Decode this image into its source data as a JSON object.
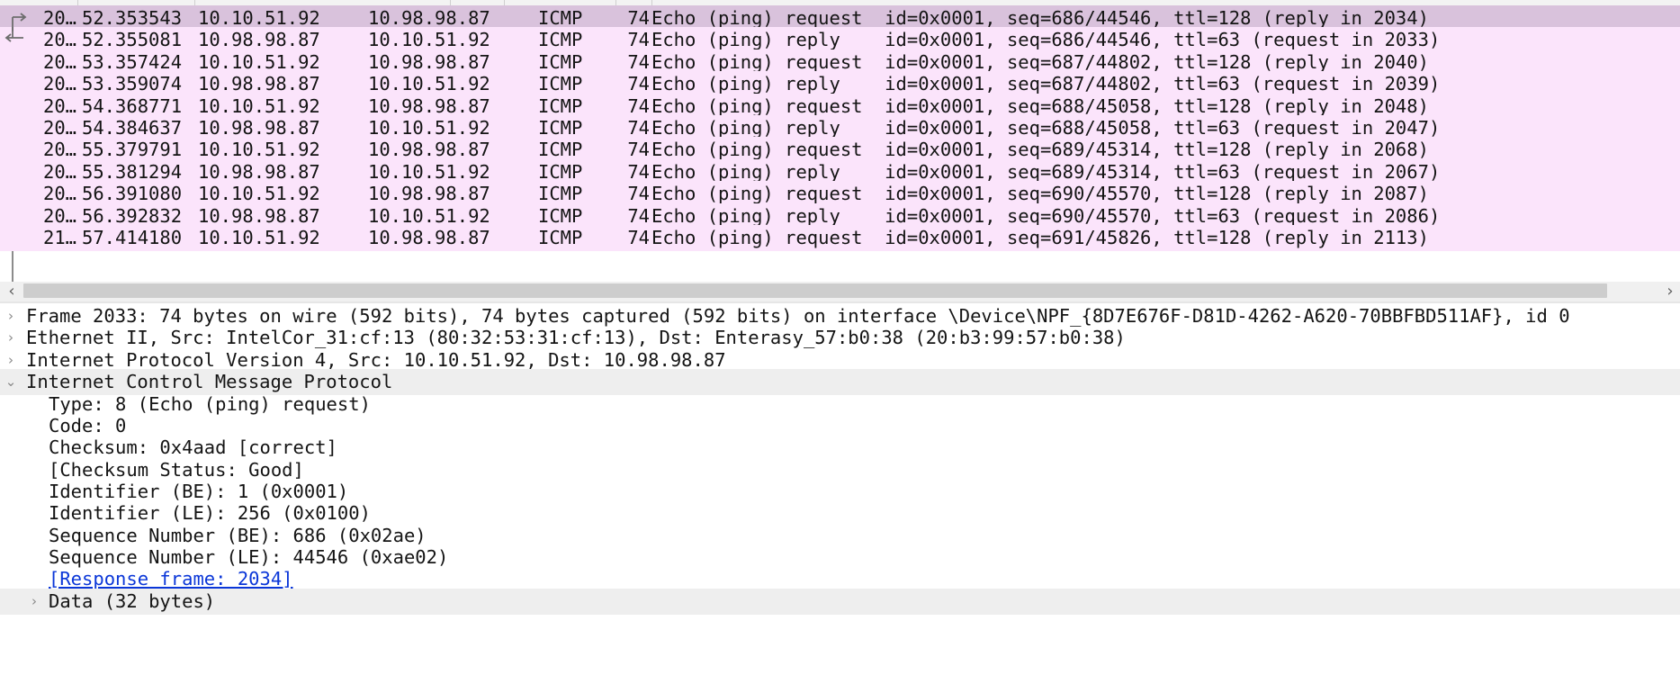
{
  "packet_list": {
    "rows": [
      {
        "no": "20…",
        "time": "52.353543",
        "src": "10.10.51.92",
        "dst": "10.98.98.87",
        "proto": "ICMP",
        "len": "74",
        "info": "Echo (ping) request  id=0x0001, seq=686/44546, ttl=128 (reply in 2034)"
      },
      {
        "no": "20…",
        "time": "52.355081",
        "src": "10.98.98.87",
        "dst": "10.10.51.92",
        "proto": "ICMP",
        "len": "74",
        "info": "Echo (ping) reply    id=0x0001, seq=686/44546, ttl=63 (request in 2033)"
      },
      {
        "no": "20…",
        "time": "53.357424",
        "src": "10.10.51.92",
        "dst": "10.98.98.87",
        "proto": "ICMP",
        "len": "74",
        "info": "Echo (ping) request  id=0x0001, seq=687/44802, ttl=128 (reply in 2040)"
      },
      {
        "no": "20…",
        "time": "53.359074",
        "src": "10.98.98.87",
        "dst": "10.10.51.92",
        "proto": "ICMP",
        "len": "74",
        "info": "Echo (ping) reply    id=0x0001, seq=687/44802, ttl=63 (request in 2039)"
      },
      {
        "no": "20…",
        "time": "54.368771",
        "src": "10.10.51.92",
        "dst": "10.98.98.87",
        "proto": "ICMP",
        "len": "74",
        "info": "Echo (ping) request  id=0x0001, seq=688/45058, ttl=128 (reply in 2048)"
      },
      {
        "no": "20…",
        "time": "54.384637",
        "src": "10.98.98.87",
        "dst": "10.10.51.92",
        "proto": "ICMP",
        "len": "74",
        "info": "Echo (ping) reply    id=0x0001, seq=688/45058, ttl=63 (request in 2047)"
      },
      {
        "no": "20…",
        "time": "55.379791",
        "src": "10.10.51.92",
        "dst": "10.98.98.87",
        "proto": "ICMP",
        "len": "74",
        "info": "Echo (ping) request  id=0x0001, seq=689/45314, ttl=128 (reply in 2068)"
      },
      {
        "no": "20…",
        "time": "55.381294",
        "src": "10.98.98.87",
        "dst": "10.10.51.92",
        "proto": "ICMP",
        "len": "74",
        "info": "Echo (ping) reply    id=0x0001, seq=689/45314, ttl=63 (request in 2067)"
      },
      {
        "no": "20…",
        "time": "56.391080",
        "src": "10.10.51.92",
        "dst": "10.98.98.87",
        "proto": "ICMP",
        "len": "74",
        "info": "Echo (ping) request  id=0x0001, seq=690/45570, ttl=128 (reply in 2087)"
      },
      {
        "no": "20…",
        "time": "56.392832",
        "src": "10.98.98.87",
        "dst": "10.10.51.92",
        "proto": "ICMP",
        "len": "74",
        "info": "Echo (ping) reply    id=0x0001, seq=690/45570, ttl=63 (request in 2086)"
      },
      {
        "no": "21…",
        "time": "57.414180",
        "src": "10.10.51.92",
        "dst": "10.98.98.87",
        "proto": "ICMP",
        "len": "74",
        "info": "Echo (ping) request  id=0x0001, seq=691/45826, ttl=128 (reply in 2113)"
      }
    ],
    "selected_row": 0,
    "colors": {
      "row_bg": "#fbe4fb",
      "selected_bg": "#d9c2dc"
    }
  },
  "details": {
    "frame": "Frame 2033: 74 bytes on wire (592 bits), 74 bytes captured (592 bits) on interface \\Device\\NPF_{8D7E676F-D81D-4262-A620-70BBFBD511AF}, id 0",
    "ethernet": "Ethernet II, Src: IntelCor_31:cf:13 (80:32:53:31:cf:13), Dst: Enterasy_57:b0:38 (20:b3:99:57:b0:38)",
    "ip": "Internet Protocol Version 4, Src: 10.10.51.92, Dst: 10.98.98.87",
    "icmp": "Internet Control Message Protocol",
    "icmp_fields": {
      "type": "Type: 8 (Echo (ping) request)",
      "code": "Code: 0",
      "checksum": "Checksum: 0x4aad [correct]",
      "checksum_status": "[Checksum Status: Good]",
      "identifier_be": "Identifier (BE): 1 (0x0001)",
      "identifier_le": "Identifier (LE): 256 (0x0100)",
      "seq_be": "Sequence Number (BE): 686 (0x02ae)",
      "seq_le": "Sequence Number (LE): 44546 (0xae02)",
      "response_frame": "[Response frame: 2034]",
      "data": "Data (32 bytes)"
    }
  },
  "icons": {
    "collapsed": "chevron-right-icon",
    "expanded": "chevron-down-icon"
  },
  "link_color": "#0a36d8"
}
